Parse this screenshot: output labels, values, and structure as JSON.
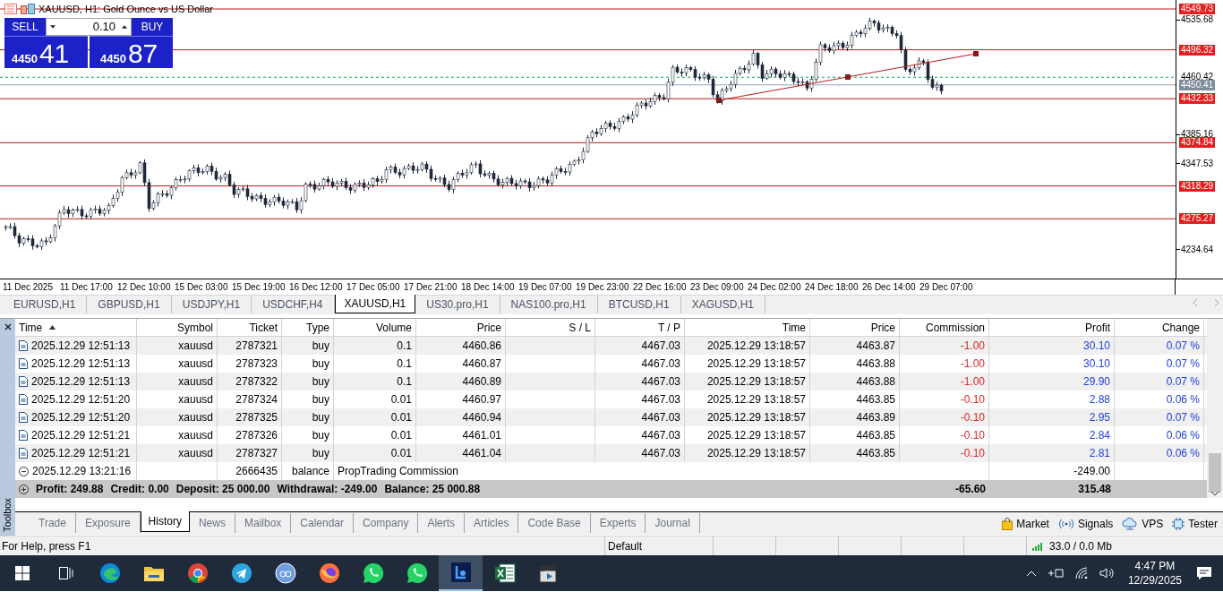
{
  "chart": {
    "title": "XAUUSD, H1: Gold Ounce vs US Dollar",
    "one_click": {
      "sell_label": "SELL",
      "buy_label": "BUY",
      "volume": "0.10",
      "sell_small": "4450",
      "sell_big": "41",
      "buy_small": "4450",
      "buy_big": "87"
    },
    "price_ticks": [
      "4535.68",
      "4385.16",
      "4347.53",
      "4234.64"
    ],
    "levels": [
      {
        "price": "4549.73",
        "kind": "line"
      },
      {
        "price": "4496.32",
        "kind": "line"
      },
      {
        "price": "4460.42",
        "kind": "ask"
      },
      {
        "price": "4450.41",
        "kind": "bid"
      },
      {
        "price": "4432.33",
        "kind": "line"
      },
      {
        "price": "4374.84",
        "kind": "line"
      },
      {
        "price": "4318.29",
        "kind": "line"
      },
      {
        "price": "4275.27",
        "kind": "line"
      }
    ],
    "time_labels": [
      "11 Dec 2025",
      "11 Dec 17:00",
      "12 Dec 10:00",
      "15 Dec 03:00",
      "15 Dec 19:00",
      "16 Dec 12:00",
      "17 Dec 05:00",
      "17 Dec 21:00",
      "18 Dec 14:00",
      "19 Dec 07:00",
      "19 Dec 23:00",
      "22 Dec 16:00",
      "23 Dec 09:00",
      "24 Dec 02:00",
      "24 Dec 18:00",
      "26 Dec 14:00",
      "29 Dec 07:00"
    ]
  },
  "chart_tabs": [
    {
      "label": "EURUSD,H1",
      "selected": false
    },
    {
      "label": "GBPUSD,H1",
      "selected": false
    },
    {
      "label": "USDJPY,H1",
      "selected": false
    },
    {
      "label": "USDCHF,H4",
      "selected": false
    },
    {
      "label": "XAUUSD,H1",
      "selected": true
    },
    {
      "label": "US30.pro,H1",
      "selected": false
    },
    {
      "label": "NAS100.pro,H1",
      "selected": false
    },
    {
      "label": "BTCUSD,H1",
      "selected": false
    },
    {
      "label": "XAGUSD,H1",
      "selected": false
    }
  ],
  "toolbox_label": "Toolbox",
  "history_table": {
    "columns": [
      {
        "label": "Time",
        "sorted": true
      },
      {
        "label": "Symbol",
        "sorted": false
      },
      {
        "label": "Ticket",
        "sorted": false
      },
      {
        "label": "Type",
        "sorted": false
      },
      {
        "label": "Volume",
        "sorted": false
      },
      {
        "label": "Price",
        "sorted": false
      },
      {
        "label": "S / L",
        "sorted": false
      },
      {
        "label": "T / P",
        "sorted": false
      },
      {
        "label": "Time",
        "sorted": false
      },
      {
        "label": "Price",
        "sorted": false
      },
      {
        "label": "Commission",
        "sorted": false
      },
      {
        "label": "Profit",
        "sorted": false
      },
      {
        "label": "Change",
        "sorted": false
      }
    ],
    "rows": [
      {
        "kind": "deal",
        "time": "2025.12.29 12:51:13",
        "symbol": "xauusd",
        "ticket": "2787321",
        "type": "buy",
        "volume": "0.1",
        "price": "4460.86",
        "tp": "4467.03",
        "close_time": "2025.12.29 13:18:57",
        "close_price": "4463.87",
        "commission": "-1.00",
        "profit": "30.10",
        "change": "0.07 %"
      },
      {
        "kind": "deal",
        "time": "2025.12.29 12:51:13",
        "symbol": "xauusd",
        "ticket": "2787323",
        "type": "buy",
        "volume": "0.1",
        "price": "4460.87",
        "tp": "4467.03",
        "close_time": "2025.12.29 13:18:57",
        "close_price": "4463.88",
        "commission": "-1.00",
        "profit": "30.10",
        "change": "0.07 %"
      },
      {
        "kind": "deal",
        "time": "2025.12.29 12:51:13",
        "symbol": "xauusd",
        "ticket": "2787322",
        "type": "buy",
        "volume": "0.1",
        "price": "4460.89",
        "tp": "4467.03",
        "close_time": "2025.12.29 13:18:57",
        "close_price": "4463.88",
        "commission": "-1.00",
        "profit": "29.90",
        "change": "0.07 %"
      },
      {
        "kind": "deal",
        "time": "2025.12.29 12:51:20",
        "symbol": "xauusd",
        "ticket": "2787324",
        "type": "buy",
        "volume": "0.01",
        "price": "4460.97",
        "tp": "4467.03",
        "close_time": "2025.12.29 13:18:57",
        "close_price": "4463.85",
        "commission": "-0.10",
        "profit": "2.88",
        "change": "0.06 %"
      },
      {
        "kind": "deal",
        "time": "2025.12.29 12:51:20",
        "symbol": "xauusd",
        "ticket": "2787325",
        "type": "buy",
        "volume": "0.01",
        "price": "4460.94",
        "tp": "4467.03",
        "close_time": "2025.12.29 13:18:57",
        "close_price": "4463.89",
        "commission": "-0.10",
        "profit": "2.95",
        "change": "0.07 %"
      },
      {
        "kind": "deal",
        "time": "2025.12.29 12:51:21",
        "symbol": "xauusd",
        "ticket": "2787326",
        "type": "buy",
        "volume": "0.01",
        "price": "4461.01",
        "tp": "4467.03",
        "close_time": "2025.12.29 13:18:57",
        "close_price": "4463.85",
        "commission": "-0.10",
        "profit": "2.84",
        "change": "0.06 %"
      },
      {
        "kind": "deal",
        "time": "2025.12.29 12:51:21",
        "symbol": "xauusd",
        "ticket": "2787327",
        "type": "buy",
        "volume": "0.01",
        "price": "4461.04",
        "tp": "4467.03",
        "close_time": "2025.12.29 13:18:57",
        "close_price": "4463.85",
        "commission": "-0.10",
        "profit": "2.81",
        "change": "0.06 %"
      },
      {
        "kind": "balance",
        "expanded": true,
        "time": "2025.12.29 13:21:16",
        "ticket": "2666435",
        "type": "balance",
        "comment": "PropTrading Commission",
        "profit": "-249.00"
      }
    ],
    "summary": {
      "expanded": false,
      "items": [
        "Profit: 249.88",
        "Credit: 0.00",
        "Deposit: 25 000.00",
        "Withdrawal: -249.00",
        "Balance: 25 000.88"
      ],
      "commission": "-65.60",
      "profit": "315.48"
    }
  },
  "bottom_tabs": [
    {
      "label": "Trade",
      "selected": false
    },
    {
      "label": "Exposure",
      "selected": false
    },
    {
      "label": "History",
      "selected": true
    },
    {
      "label": "News",
      "selected": false
    },
    {
      "label": "Mailbox",
      "selected": false
    },
    {
      "label": "Calendar",
      "selected": false
    },
    {
      "label": "Company",
      "selected": false
    },
    {
      "label": "Alerts",
      "selected": false
    },
    {
      "label": "Articles",
      "selected": false
    },
    {
      "label": "Code Base",
      "selected": false
    },
    {
      "label": "Experts",
      "selected": false
    },
    {
      "label": "Journal",
      "selected": false
    }
  ],
  "tool_links": [
    {
      "label": "Market",
      "kind": "market"
    },
    {
      "label": "Signals",
      "kind": "signals"
    },
    {
      "label": "VPS",
      "kind": "vps"
    },
    {
      "label": "Tester",
      "kind": "tester"
    }
  ],
  "status_bar": {
    "help": "For Help, press F1",
    "profile": "Default",
    "traffic": "33.0 / 0.0 Mb"
  },
  "taskbar": {
    "apps": [
      {
        "kind": "start",
        "selected": false
      },
      {
        "kind": "taskview",
        "selected": false
      },
      {
        "kind": "edge",
        "selected": false
      },
      {
        "kind": "folder",
        "selected": false
      },
      {
        "kind": "chrome",
        "selected": false
      },
      {
        "kind": "telegram",
        "selected": false
      },
      {
        "kind": "qb",
        "selected": false
      },
      {
        "kind": "firefox",
        "selected": false
      },
      {
        "kind": "whatsapp",
        "selected": false
      },
      {
        "kind": "whatsapp2",
        "selected": false
      },
      {
        "kind": "trader",
        "selected": true
      },
      {
        "kind": "excel",
        "selected": false
      },
      {
        "kind": "video",
        "selected": false
      }
    ],
    "time": "4:47 PM",
    "date": "12/29/2025"
  }
}
